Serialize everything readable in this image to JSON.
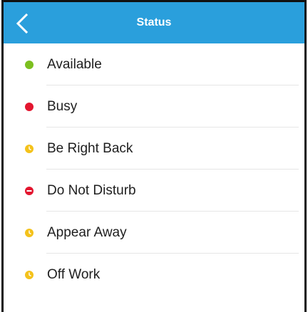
{
  "header": {
    "title": "Status",
    "back_icon": "chevron-left-icon",
    "background": "#2a9fdc"
  },
  "statuses": [
    {
      "label": "Available",
      "icon": "available-dot-icon",
      "color": "#7cbf1f"
    },
    {
      "label": "Busy",
      "icon": "busy-dot-icon",
      "color": "#e3162f"
    },
    {
      "label": "Be Right Back",
      "icon": "clock-icon",
      "color": "#f4c21b"
    },
    {
      "label": "Do Not Disturb",
      "icon": "minus-circle-icon",
      "color": "#e3162f"
    },
    {
      "label": "Appear Away",
      "icon": "clock-icon",
      "color": "#f4c21b"
    },
    {
      "label": "Off Work",
      "icon": "clock-icon",
      "color": "#f4c21b"
    }
  ]
}
